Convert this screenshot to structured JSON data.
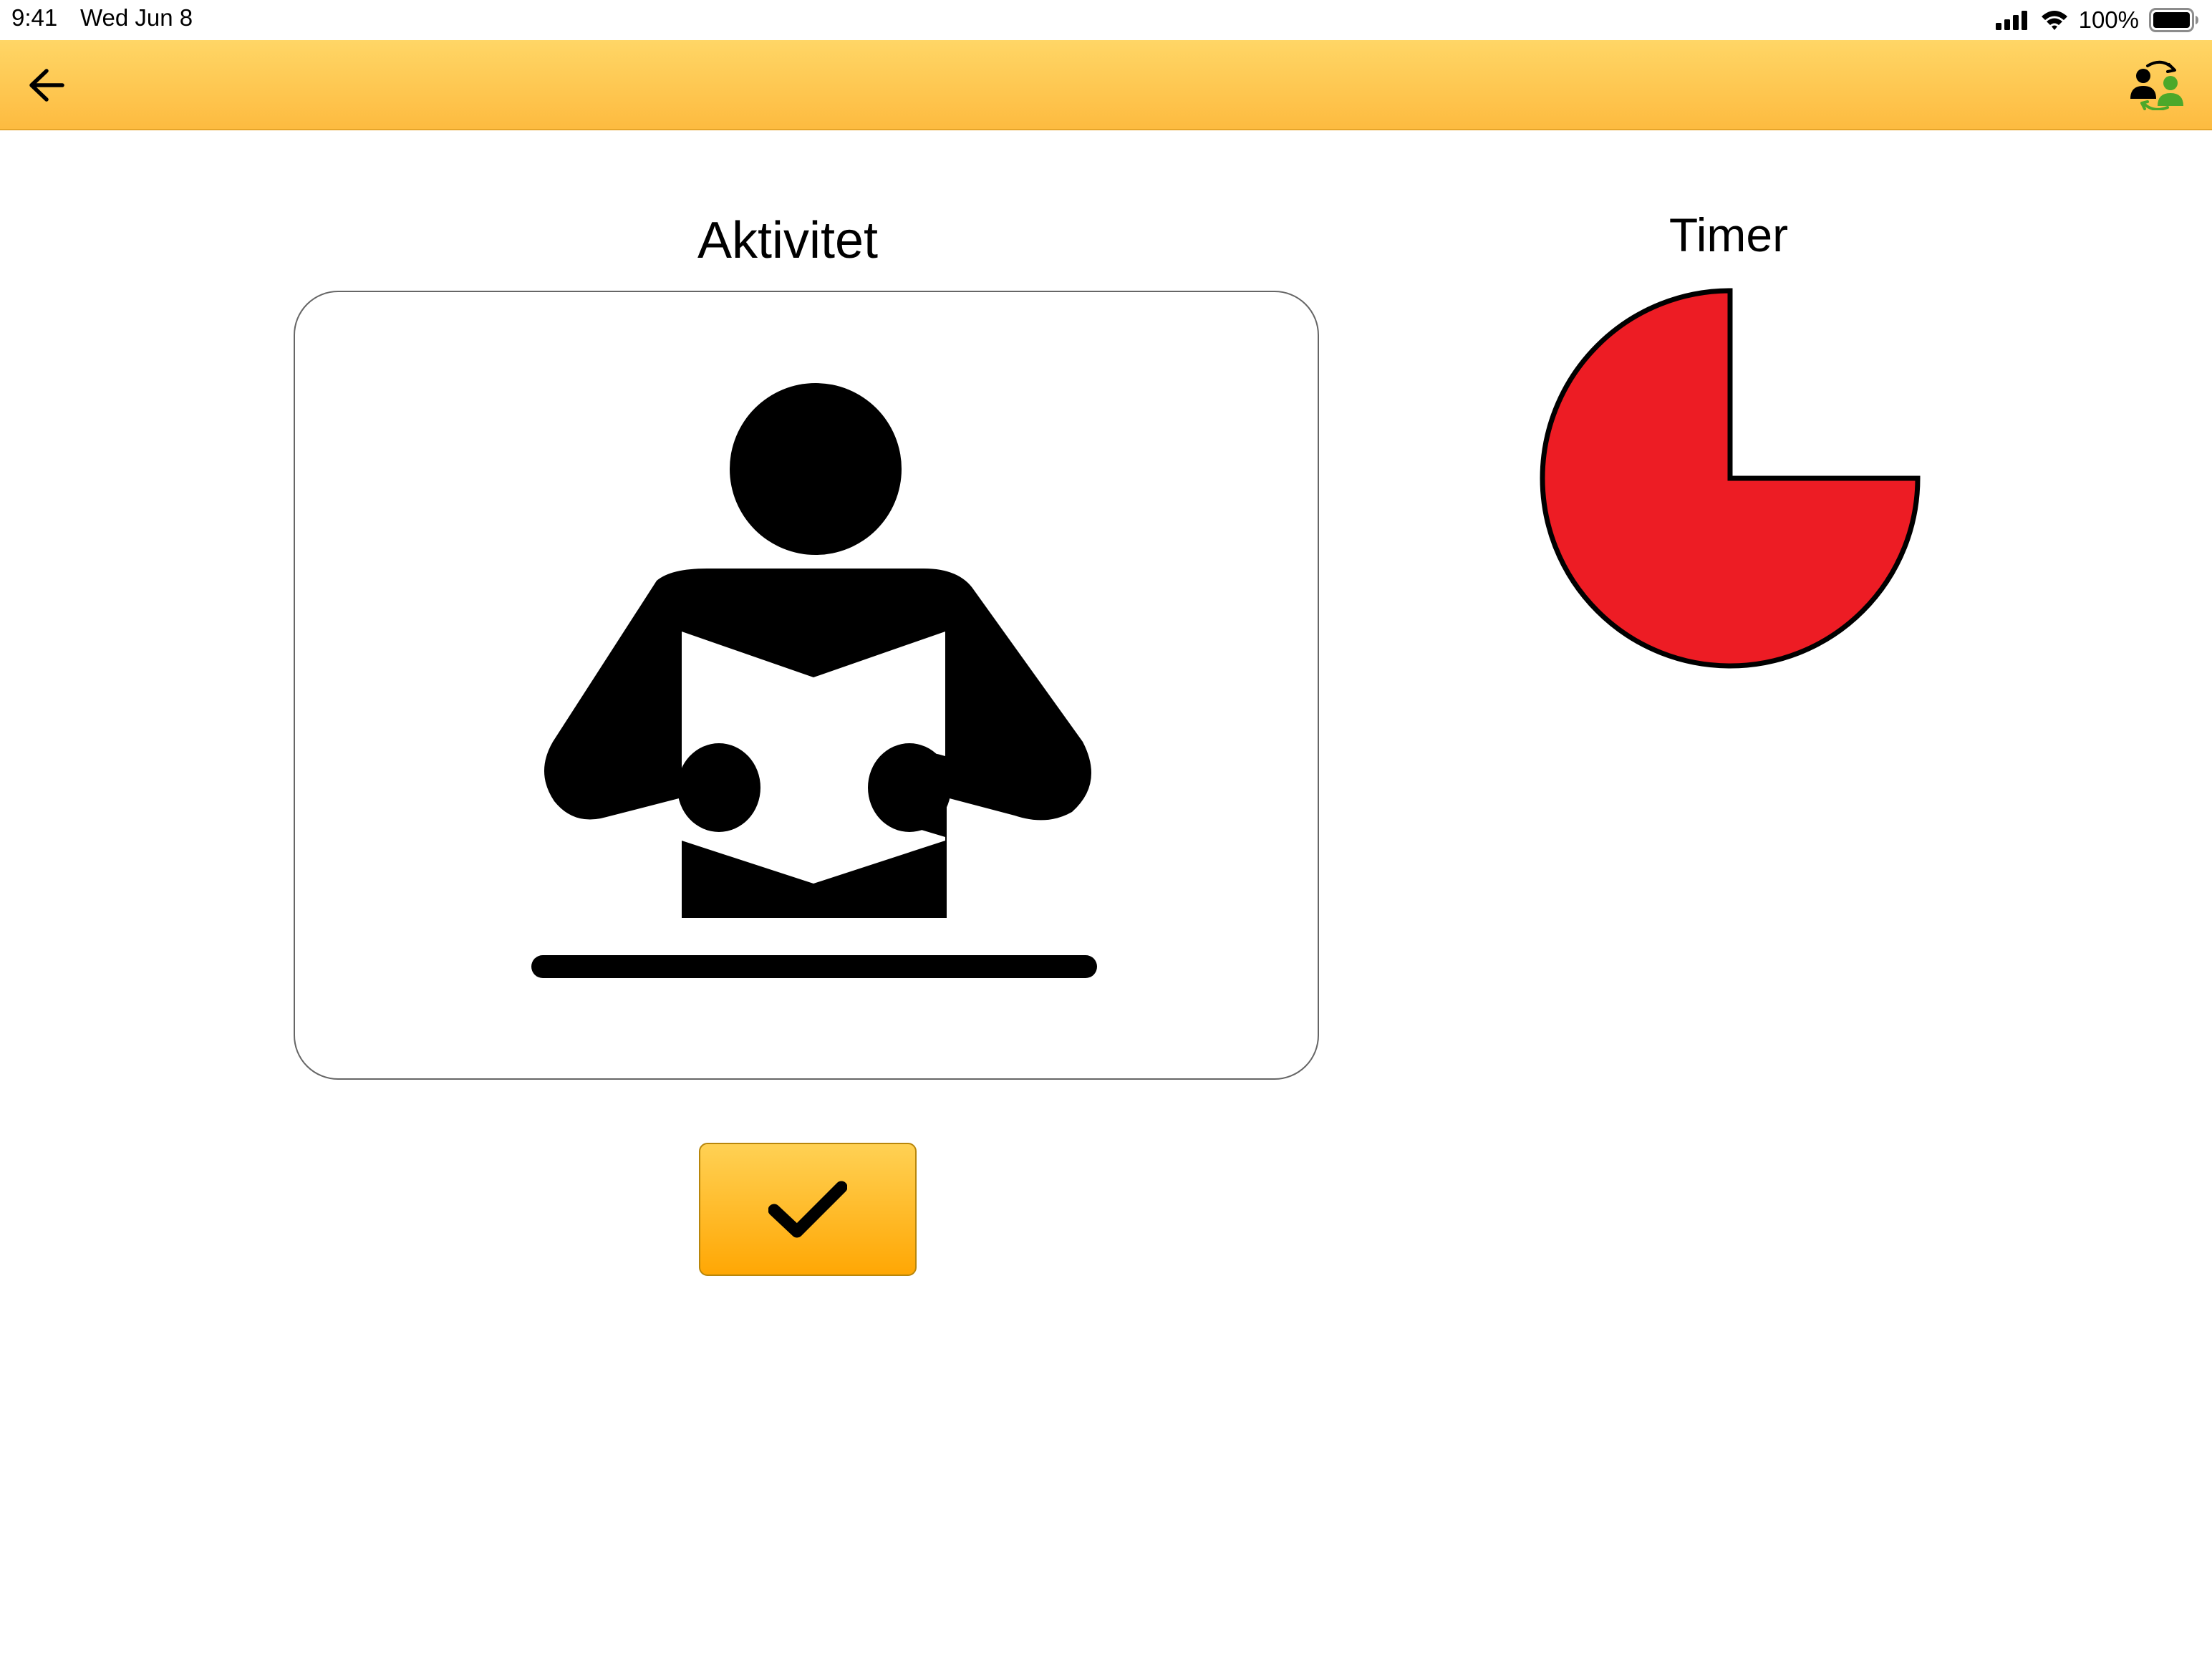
{
  "status_bar": {
    "time": "9:41",
    "date": "Wed Jun 8",
    "battery": "100%"
  },
  "toolbar": {
    "back_icon": "arrow-left-icon",
    "switch_user_icon": "switch-user-icon",
    "background_color": "#fdc54d"
  },
  "activity": {
    "title": "Aktivitet",
    "pictogram": "person-reading-icon"
  },
  "timer": {
    "title": "Timer",
    "remaining_fraction": 0.75,
    "color": "#ed1c24"
  },
  "done_button": {
    "icon": "checkmark-icon"
  }
}
